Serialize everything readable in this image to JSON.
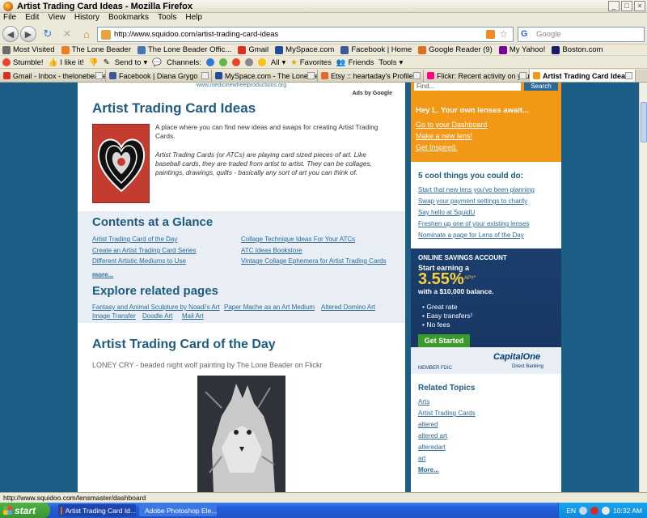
{
  "window": {
    "title": "Artist Trading Card Ideas - Mozilla Firefox"
  },
  "menu": [
    "File",
    "Edit",
    "View",
    "History",
    "Bookmarks",
    "Tools",
    "Help"
  ],
  "nav": {
    "url": "http://www.squidoo.com/artist-trading-card-ideas",
    "search_placeholder": "Google"
  },
  "bookmarks": [
    {
      "label": "Most Visited",
      "color": "#6b6b6b"
    },
    {
      "label": "The Lone Beader",
      "color": "#f47c20"
    },
    {
      "label": "The Lone Beader Offic...",
      "color": "#4a76b8"
    },
    {
      "label": "Gmail",
      "color": "#d93025"
    },
    {
      "label": "MySpace.com",
      "color": "#1d4d9b"
    },
    {
      "label": "Facebook | Home",
      "color": "#3b5998"
    },
    {
      "label": "Google Reader (9)",
      "color": "#e06c1d"
    },
    {
      "label": "My Yahoo!",
      "color": "#7b0099"
    },
    {
      "label": "Boston.com",
      "color": "#1a1a6e"
    }
  ],
  "stumble": {
    "stumble": "Stumble!",
    "like": "I like it!",
    "send": "Send to",
    "channels": "Channels:",
    "all": "All",
    "favorites": "Favorites",
    "friends": "Friends",
    "tools": "Tools"
  },
  "tabs": [
    {
      "label": "Gmail - Inbox - thelonebeader...",
      "color": "#d93025",
      "active": false
    },
    {
      "label": "Facebook | Diana Grygo",
      "color": "#3b5998",
      "active": false
    },
    {
      "label": "MySpace.com - The Lone Bead...",
      "color": "#1d4d9b",
      "active": false
    },
    {
      "label": "Etsy :: heartaday's Profile",
      "color": "#e8672a",
      "active": false
    },
    {
      "label": "Flickr: Recent activity on your ...",
      "color": "#ff0084",
      "active": false
    },
    {
      "label": "Artist Trading Card Ideas",
      "color": "#f29716",
      "active": true
    }
  ],
  "page": {
    "ad_url": "www.medicinewheelproductions.org",
    "ads_by": "Ads by Google",
    "title": "Artist Trading Card Ideas",
    "intro": "A place where you can find new ideas and swaps for creating Artist Trading Cards.",
    "intro2": "Artist Trading Cards (or ATCs) are playing card sized pieces of art. Like baseball cards, they are traded from artist to artist. They can be collages, paintings, drawings, quilts - basically any sort of art you can think of.",
    "contents_heading": "Contents at a Glance",
    "contents_links": [
      "Artist Trading Card of the Day",
      "Create an Artist Trading Card Series",
      "Different Artistic Mediums to Use",
      "Collage Technique Ideas For Your ATCs",
      "ATC Ideas Bookstore",
      "Vintage Collage Ephemera for Artist Trading Cards"
    ],
    "more": "more...",
    "explore_heading": "Explore related pages",
    "explore_links": [
      "Fantasy and Animal Sculpture by Noadi's Art",
      "Paper Mache as an Art Medium",
      "Altered Domino Art",
      "Image Transfer",
      "Doodle Art",
      "Mail Art"
    ],
    "potd_heading": "Artist Trading Card of the Day",
    "potd_sub": "LONEY CRY - beaded night wolf painting by The Lone Beader on Flickr"
  },
  "sidebar": {
    "search_value": "Find...",
    "search_btn": "Search",
    "hey": "Hey L.  Your own lenses await...",
    "orange_links": [
      "Go to your Dashboard",
      "Make a new lens!",
      "Get Inspired."
    ],
    "cool_heading": "5 cool things you could do:",
    "cool_links": [
      "Start that new lens you've been planning",
      "Swap your payment settings to charity",
      "Say hello at SquidU",
      "Freshen up one of your existing lenses",
      "Nominate a page for Lens of the Day"
    ],
    "ad": {
      "l1": "ONLINE SAVINGS ACCOUNT",
      "l2": "Start earning a",
      "rate": "3.55%",
      "apy": "APY*",
      "l3": "with a $10,000 balance.",
      "bullets": [
        "Great rate",
        "Easy transfers¹",
        "No fees"
      ],
      "cta": "Get Started",
      "member": "MEMBER FDIC",
      "brand": "CapitalOne",
      "brand_sub": "Direct Banking"
    },
    "related_heading": "Related Topics",
    "related_links": [
      "Arts",
      "Artist Trading Cards",
      "altered",
      "altered art",
      "alteredart",
      "art",
      "More..."
    ]
  },
  "status": "http://www.squidoo.com/lensmaster/dashboard",
  "taskbar": {
    "start": "start",
    "tasks": [
      {
        "label": "Artist Trading Card Id...",
        "color": "#e36b10"
      },
      {
        "label": "Adobe Photoshop Ele...",
        "color": "#2a6fc9"
      }
    ],
    "lang": "EN",
    "clock": "10:32 AM"
  }
}
